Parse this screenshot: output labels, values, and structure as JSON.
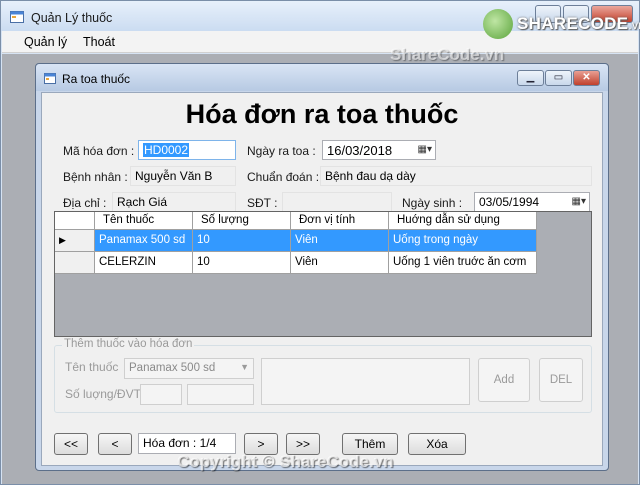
{
  "window": {
    "title": "Quản Lý thuốc"
  },
  "menu": {
    "items": [
      "Quản lý",
      "Thoát"
    ]
  },
  "child": {
    "title": "Ra toa thuốc"
  },
  "form": {
    "heading": "Hóa đơn ra toa thuốc",
    "invoice_label": "Mã hóa đơn :",
    "invoice_value": "HD0002",
    "date_label": "Ngày ra toa :",
    "date_value": "16/03/2018",
    "patient_label": "Bệnh nhân :",
    "patient_value": "Nguyễn Văn B",
    "diagnosis_label": "Chuẩn đoán :",
    "diagnosis_value": "Bệnh đau dạ dày",
    "address_label": "Địa chỉ :",
    "address_value": "Rạch Giá",
    "phone_label": "SĐT :",
    "phone_value": "",
    "dob_label": "Ngày sinh :",
    "dob_value": "03/05/1994"
  },
  "grid": {
    "columns": [
      "Tên thuốc",
      "Số lượng",
      "Đơn vị tính",
      "Huớng dẫn sử dụng"
    ],
    "rows": [
      [
        "Panamax 500 sd",
        "10",
        "Viên",
        "Uống trong ngày"
      ],
      [
        "CELERZIN",
        "10",
        "Viên",
        "Uống 1 viên truớc ăn cơm"
      ]
    ],
    "selected_row": 0
  },
  "add_group": {
    "title": "Thêm thuốc vào hóa đơn",
    "drug_label": "Tên thuốc",
    "drug_value": "Panamax 500 sd",
    "qty_label": "Số luợng/ĐVT",
    "add_button": "Add",
    "del_button": "DEL"
  },
  "nav": {
    "first": "<<",
    "prev": "<",
    "position": "Hóa đơn : 1/4",
    "next": ">",
    "last": ">>",
    "new_button": "Thêm",
    "delete_button": "Xóa"
  },
  "watermarks": {
    "logo": "SHARECODE",
    "logo_suffix": ".vn",
    "mid": "ShareCode.vn",
    "bottom": "Copyright © ShareCode.vn"
  },
  "icons": {
    "app_icon": "window-icon",
    "picker": "calendar-dropdown-icon",
    "row_pointer": "row-pointer-icon"
  }
}
